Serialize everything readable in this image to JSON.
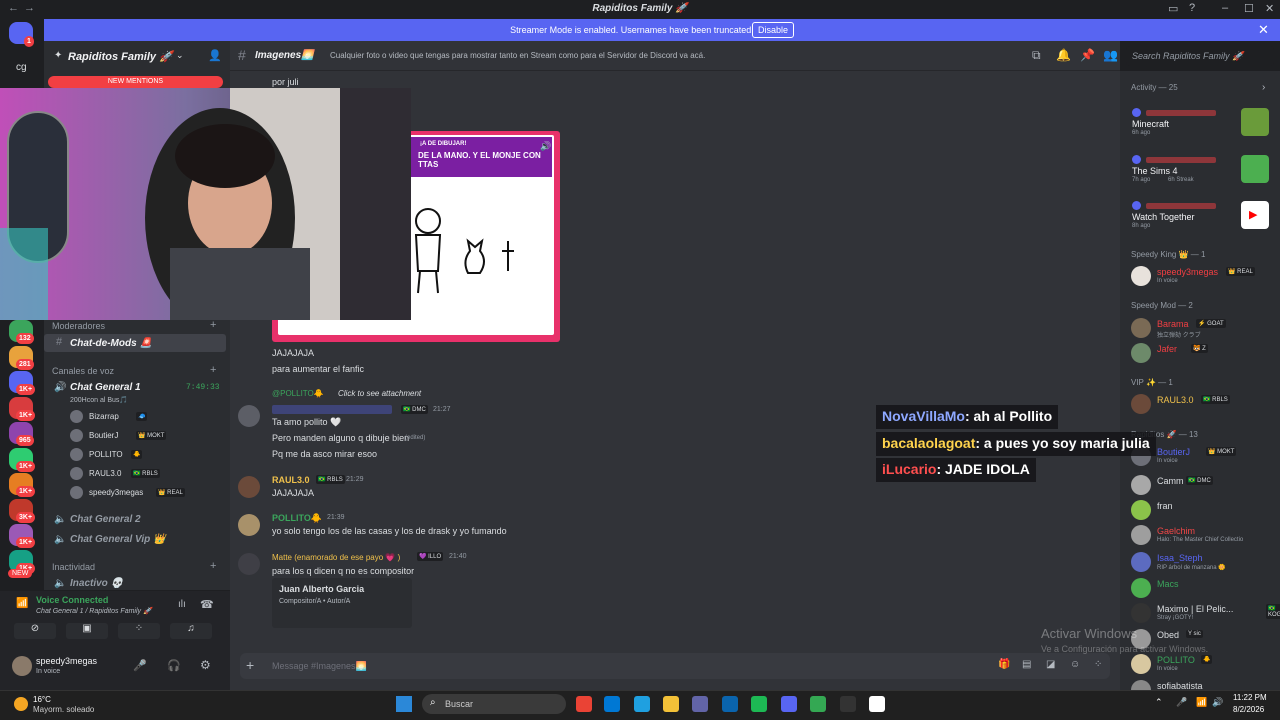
{
  "window": {
    "title": "Rapiditos Family 🚀"
  },
  "banner": {
    "message": "Streamer Mode is enabled. Usernames have been truncated.",
    "disable_label": "Disable"
  },
  "rail": {
    "top_badge": "1",
    "dm_label": "cg",
    "badges": [
      "132",
      "281",
      "1K+",
      "1K+",
      "965",
      "1K+",
      "1K+",
      "3K+",
      "1K+",
      "1K+"
    ],
    "new_label": "NEW"
  },
  "sidebar": {
    "server_name": "Rapiditos Family 🚀",
    "new_mentions": "NEW MENTIONS",
    "moderadores": "Moderadores",
    "chat_de_mods": "Chat-de-Mods 🚨",
    "canales_de_voz": "Canales de voz",
    "chat_general_1": "Chat General 1",
    "chat_general_1_timer": "7:49:33",
    "chat_general_1_status": "200Hcon al Bus🎵",
    "voice_users": [
      {
        "name": "Bizarrap",
        "tag": "🧢"
      },
      {
        "name": "BoutierJ",
        "tag": "👑 MOKT"
      },
      {
        "name": "POLLITO",
        "tag": "🐥"
      },
      {
        "name": "RAUL3.0",
        "tag": "🇧🇷 RBLS"
      },
      {
        "name": "speedy3megas",
        "tag": "👑 REAL"
      }
    ],
    "chat_general_2": "Chat General 2",
    "chat_general_vip": "Chat General Vip 👑",
    "inactividad": "Inactividad",
    "inactivo": "Inactivo 💀",
    "voice_connected": "Voice Connected",
    "voice_location": "Chat General 1 / Rapiditos Family 🚀",
    "user_name": "speedy3megas",
    "user_status": "In voice"
  },
  "channel": {
    "name": "Imagenes🌅",
    "topic": "Cualquier foto o video que tengas para mostrar tanto en Stream como para el Servidor de Discord va acá.",
    "search_placeholder": "Search Rapiditos Family 🚀",
    "composer_placeholder": "Message #Imagenes🌅"
  },
  "messages": {
    "por_juli": "por juli",
    "embed_banner": "¡A DE DIBUJAR!",
    "embed_title": "DE LA MANO. Y EL MONJE CON TTAS",
    "jaja": "JAJAJAJA",
    "aumentar": "para aumentar el fanfic",
    "reply_user": "@POLLITO🐥",
    "reply_text": "Click to see attachment",
    "m1_tag": "🇧🇷 DMC",
    "m1_time": "21:27",
    "m1_lines": [
      "Ta amo pollito 🤍",
      "Pero manden alguno q dibuje bien",
      "Pq me da asco mirar esoo"
    ],
    "edited": "(edited)",
    "m2_user": "RAUL3.0",
    "m2_tag": "🇧🇷 RBLS",
    "m2_time": "21:29",
    "m2_text": "JAJAJAJA",
    "m3_user": "POLLITO🐥",
    "m3_time": "21:39",
    "m3_text": "yo solo tengo los de las casas y los de drask y yo fumando",
    "m4_user": "Matte (enamorado de ese payo 💗 )",
    "m4_tag": "💜 ILLO",
    "m4_time": "21:40",
    "m4_text": "para los q dicen q no es compositor",
    "m4_embed_name": "Juan Alberto Garcia",
    "m4_embed_role": "Compositor/A • Autor/A"
  },
  "overlay": [
    {
      "name": "NovaVillaMo",
      "text": ": ah al Pollito",
      "color": "#8ea8ff"
    },
    {
      "name": "bacalaolagoat",
      "text": ": a pues yo soy maria julia",
      "color": "#ffd34d"
    },
    {
      "name": "iLucario",
      "text": ": JADE IDOLA",
      "color": "#ff4f4f"
    }
  ],
  "members": {
    "activity_header": "Activity — 25",
    "activities": [
      {
        "title": "Minecraft",
        "time": "6h ago"
      },
      {
        "title": "The Sims 4",
        "time": "7h ago",
        "streak": "6h Streak"
      },
      {
        "title": "Watch Together",
        "time": "8h ago"
      }
    ],
    "speedy_king": "Speedy King 👑 — 1",
    "speedy_mod": "Speedy Mod — 2",
    "vip": "VIP ✨ — 1",
    "rapiditos": "Rapiditos 🚀 — 13",
    "list": [
      {
        "name": "speedy3megas",
        "tag": "👑 REAL",
        "sub": "In voice",
        "color": "#f23f43"
      },
      {
        "name": "Barama",
        "tag": "⚡ GOAT",
        "sub": "独立弾劾 クラブ",
        "color": "#f23f43"
      },
      {
        "name": "Jafer",
        "tag": "🐯 Z",
        "sub": "",
        "color": "#f23f43"
      },
      {
        "name": "RAUL3.0",
        "tag": "🇧🇷 RBLS",
        "sub": "",
        "color": "#f0c14b"
      },
      {
        "name": "BoutierJ",
        "tag": "👑 MOKT",
        "sub": "In voice",
        "color": "#5865f2"
      },
      {
        "name": "Camm",
        "tag": "🇧🇷 DMC",
        "sub": "",
        "color": "#dbdee1"
      },
      {
        "name": "fran",
        "tag": "",
        "sub": "",
        "color": "#dbdee1"
      },
      {
        "name": "Gaelchim",
        "tag": "",
        "sub": "Halo: The Master Chief Collectio",
        "color": "#f04747"
      },
      {
        "name": "Isaa_Steph",
        "tag": "",
        "sub": "RIP árbol de manzana 🌼",
        "color": "#5865f2"
      },
      {
        "name": "Macs",
        "tag": "",
        "sub": "",
        "color": "#3ba55c"
      },
      {
        "name": "Maximo | El Pelic...",
        "tag": "🇧🇷 KOGA",
        "sub": "Stray ¡GOTY!",
        "color": "#dbdee1"
      },
      {
        "name": "Obed",
        "tag": "Y sic",
        "sub": "",
        "color": "#dbdee1"
      },
      {
        "name": "POLLITO",
        "tag": "🐥",
        "sub": "In voice",
        "color": "#3ba55c"
      },
      {
        "name": "sofiabatista",
        "tag": "",
        "sub": "",
        "color": "#dbdee1"
      }
    ]
  },
  "activate_windows": {
    "title": "Activar Windows",
    "sub": "Ve a Configuración para activar Windows."
  },
  "taskbar": {
    "weather_temp": "16°C",
    "weather_desc": "Mayorm. soleado",
    "search": "Buscar",
    "time": "11:22 PM",
    "date": "8/2/2026"
  },
  "colors": {
    "blurple": "#5865f2",
    "rail_bg": "#1e1f22",
    "sidebar_bg": "#2b2d31",
    "main_bg": "#313338"
  }
}
